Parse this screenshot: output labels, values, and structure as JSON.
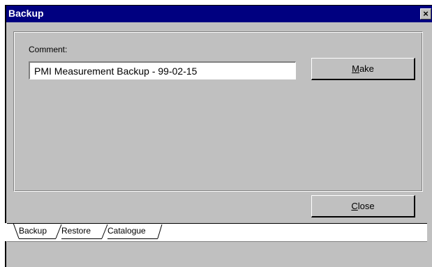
{
  "window": {
    "title": "Backup",
    "close_glyph": "✕",
    "titlebar_color": "#000080",
    "face_color": "#c0c0c0"
  },
  "comment": {
    "label": "Comment:",
    "value": "PMI Measurement Backup - 99-02-15"
  },
  "buttons": {
    "make": {
      "mnemonic": "M",
      "rest": "ake"
    },
    "close": {
      "mnemonic": "C",
      "rest": "lose"
    }
  },
  "tabs": [
    {
      "label": "Backup",
      "active": true
    },
    {
      "label": "Restore",
      "active": false
    },
    {
      "label": "Catalogue",
      "active": false
    }
  ]
}
